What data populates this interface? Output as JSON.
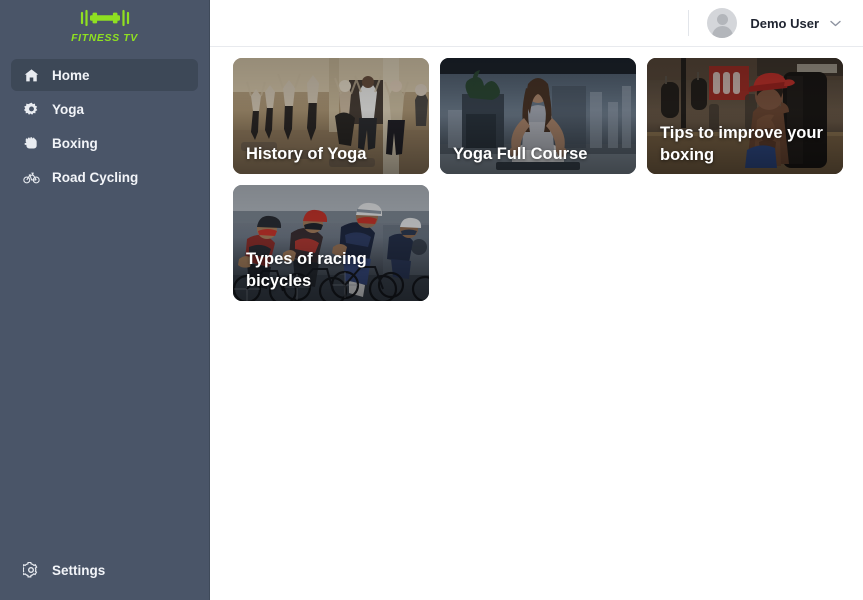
{
  "brand": {
    "name": "FITNESS TV",
    "logo_icon": "dumbbell-icon",
    "color": "#8fe021"
  },
  "sidebar": {
    "background_color": "#4a5568",
    "active_item_color": "#3d4857",
    "items": [
      {
        "id": "home",
        "label": "Home",
        "icon": "home-icon",
        "active": true
      },
      {
        "id": "yoga",
        "label": "Yoga",
        "icon": "yoga-gear-icon",
        "active": false
      },
      {
        "id": "boxing",
        "label": "Boxing",
        "icon": "fist-icon",
        "active": false
      },
      {
        "id": "road-cycling",
        "label": "Road Cycling",
        "icon": "bicycle-icon",
        "active": false
      }
    ],
    "bottom_item": {
      "id": "settings",
      "label": "Settings",
      "icon": "gear-icon"
    }
  },
  "header": {
    "user_name": "Demo User",
    "avatar_icon": "user-avatar-icon",
    "dropdown_icon": "chevron-down-icon"
  },
  "main": {
    "cards": [
      {
        "id": "history-of-yoga",
        "title": "History of Yoga",
        "image_description": "yoga class in studio, people in warrior pose",
        "palette": [
          "#6d5a46",
          "#b29b7c",
          "#3a2f26",
          "#d8c7ad"
        ]
      },
      {
        "id": "yoga-full-course",
        "title": "Yoga Full Course",
        "image_description": "woman meditating in lotus pose on rooftop at dusk",
        "palette": [
          "#2b3744",
          "#5e6d7d",
          "#1a222c",
          "#8a97a5"
        ]
      },
      {
        "id": "tips-to-improve-your-boxing",
        "title": "Tips to improve your boxing",
        "image_description": "boxer in red cap sitting in gym with punching bags",
        "palette": [
          "#2a241f",
          "#6b4b3a",
          "#1b1613",
          "#a8472f"
        ]
      },
      {
        "id": "types-of-racing-bicycles",
        "title": "Types of racing bicycles",
        "image_description": "peloton of road cyclists in blue and red jerseys",
        "palette": [
          "#2f3c52",
          "#8a2a2a",
          "#20283a",
          "#c8ccd2"
        ]
      }
    ]
  }
}
